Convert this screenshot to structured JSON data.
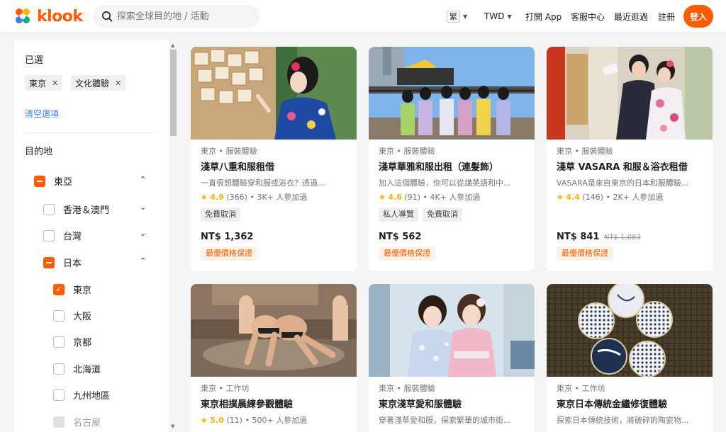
{
  "header": {
    "brand": "klook",
    "search_placeholder": "探索全球目的地 / 活動",
    "lang": "繁",
    "currency": "TWD",
    "open_app": "打開 App",
    "support": "客服中心",
    "recent": "最近逛過",
    "register": "註冊",
    "login": "登入"
  },
  "colors": {
    "brand": "#ff5b00",
    "link": "#3b7de9",
    "star": "#ffb400"
  },
  "sidebar": {
    "selected_title": "已選",
    "selected_tags": [
      "東京",
      "文化體驗"
    ],
    "clear_label": "清空選項",
    "destination_title": "目的地",
    "tree": [
      {
        "label": "東亞",
        "state": "partial",
        "expanded": true
      },
      {
        "label": "香港＆澳門",
        "state": "unchecked",
        "expanded": false
      },
      {
        "label": "台灣",
        "state": "unchecked",
        "expanded": false
      },
      {
        "label": "日本",
        "state": "partial",
        "expanded": true
      },
      {
        "label": "東京",
        "state": "checked"
      },
      {
        "label": "大阪",
        "state": "unchecked"
      },
      {
        "label": "京都",
        "state": "unchecked"
      },
      {
        "label": "北海道",
        "state": "unchecked"
      },
      {
        "label": "九州地區",
        "state": "unchecked"
      },
      {
        "label": "名古屋",
        "state": "disabled"
      }
    ]
  },
  "cards": [
    {
      "category": "東京 • 服裝體驗",
      "title": "淺草八重和服租借",
      "desc": "一直很想體驗穿和服或浴衣？透過...",
      "rating": "4.9",
      "reviews": "(366)",
      "booked": "• 3K+ 人參加過",
      "badges": [
        "免費取消"
      ],
      "price": "NT$ 1,362",
      "old_price": "",
      "best": "最優價格保證",
      "image": "kimono-shrine"
    },
    {
      "category": "東京 • 服裝體驗",
      "title": "淺草華雅和服出租（連髮飾）",
      "desc": "加入這個體驗，你可以從講英語和中...",
      "rating": "4.6",
      "reviews": "(91)",
      "booked": "• 4K+ 人參加過",
      "badges": [
        "私人導覽",
        "免費取消"
      ],
      "price": "NT$ 562",
      "old_price": "",
      "best": "最優價格保證",
      "image": "kimono-group"
    },
    {
      "category": "東京 • 服裝體驗",
      "title": "淺草 VASARA 和服＆浴衣租借",
      "desc": "VASARA是來自東京的日本和服體驗...",
      "rating": "4.4",
      "reviews": "(146)",
      "booked": "• 2K+ 人參加過",
      "badges": [],
      "price": "NT$ 841",
      "old_price": "NT$ 1,083",
      "best": "最優價格保證",
      "image": "kimono-couple"
    },
    {
      "category": "東京 • 工作坊",
      "title": "東京相撲晨練參觀體驗",
      "desc": "",
      "rating": "5.0",
      "reviews": "(11)",
      "booked": "• 500+ 人參加過",
      "badges": [],
      "price": "",
      "old_price": "",
      "best": "",
      "image": "sumo"
    },
    {
      "category": "東京 • 服裝體驗",
      "title": "東京淺草愛和服體驗",
      "desc": "穿著淺草愛和服，探索繁華的城市街...",
      "rating": "",
      "reviews": "",
      "booked": "",
      "badges": [],
      "price": "",
      "old_price": "",
      "best": "",
      "image": "kimono-two-girls"
    },
    {
      "category": "東京 • 工作坊",
      "title": "東京日本傳統金繼修復體驗",
      "desc": "探索日本傳統技術，將破碎的陶瓷物...",
      "rating": "",
      "reviews": "",
      "booked": "",
      "badges": [],
      "price": "",
      "old_price": "",
      "best": "",
      "image": "kintsugi-plates"
    }
  ]
}
